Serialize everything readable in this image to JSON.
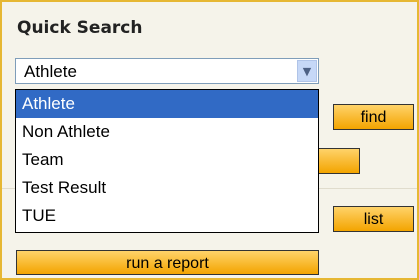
{
  "search": {
    "title": "Quick Search",
    "selected_value": "Athlete",
    "options": [
      "Athlete",
      "Non Athlete",
      "Team",
      "Test Result",
      "TUE"
    ]
  },
  "buttons": {
    "find": "find",
    "list": "list",
    "report": "run a report"
  },
  "colors": {
    "accent_orange": "#f3a400",
    "selection_blue": "#316ac5",
    "panel_bg": "#f5f3ea"
  }
}
